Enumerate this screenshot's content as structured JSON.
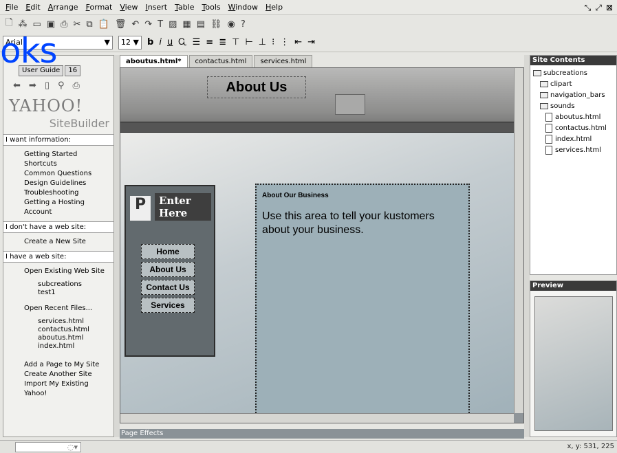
{
  "menubar": [
    "File",
    "Edit",
    "Arrange",
    "Format",
    "View",
    "Insert",
    "Table",
    "Tools",
    "Window",
    "Help"
  ],
  "window_controls": [
    "restore-icon",
    "maximize-icon",
    "close-icon"
  ],
  "toolbar": {
    "font": "Arial",
    "size": "12"
  },
  "left_panel": {
    "tabs": [
      "User Guide",
      "16"
    ],
    "logo_top": "YAHOO!",
    "logo_bottom": "SiteBuilder",
    "section1": "I want information:",
    "info_items": [
      "Getting Started",
      "Shortcuts",
      "Common Questions",
      "Design Guidelines",
      "Troubleshooting",
      "Getting a Hosting Account"
    ],
    "section2": "I don't have a web site:",
    "create_item": "Create a New Site",
    "section3": "I have a web site:",
    "open_existing": "Open Existing Web Site",
    "sites": [
      "subcreations",
      "test1"
    ],
    "open_recent": "Open Recent Files...",
    "recent": [
      "services.html",
      "contactus.html",
      "aboutus.html",
      "index.html"
    ],
    "actions": [
      "Add a Page to My Site",
      "Create Another Site",
      "Import My Existing Yahoo!"
    ]
  },
  "doc_tabs": [
    "aboutus.html*",
    "contactus.html",
    "services.html"
  ],
  "page": {
    "title": "About Us",
    "sign": "Enter Here",
    "badge": "P",
    "nav": [
      "Home",
      "About Us",
      "Contact Us",
      "Services"
    ],
    "content_heading": "About Our Business",
    "content_body": "Use this area to tell your kustomers about your business."
  },
  "page_effects": "Page Effects",
  "site_contents": {
    "header": "Site Contents",
    "root": "subcreations",
    "folders": [
      "clipart",
      "navigation_bars",
      "sounds"
    ],
    "files": [
      "aboutus.html",
      "contactus.html",
      "index.html",
      "services.html"
    ]
  },
  "preview": {
    "header": "Preview"
  },
  "status": {
    "coords": "x, y: 531, 225"
  },
  "watermark": "oks"
}
